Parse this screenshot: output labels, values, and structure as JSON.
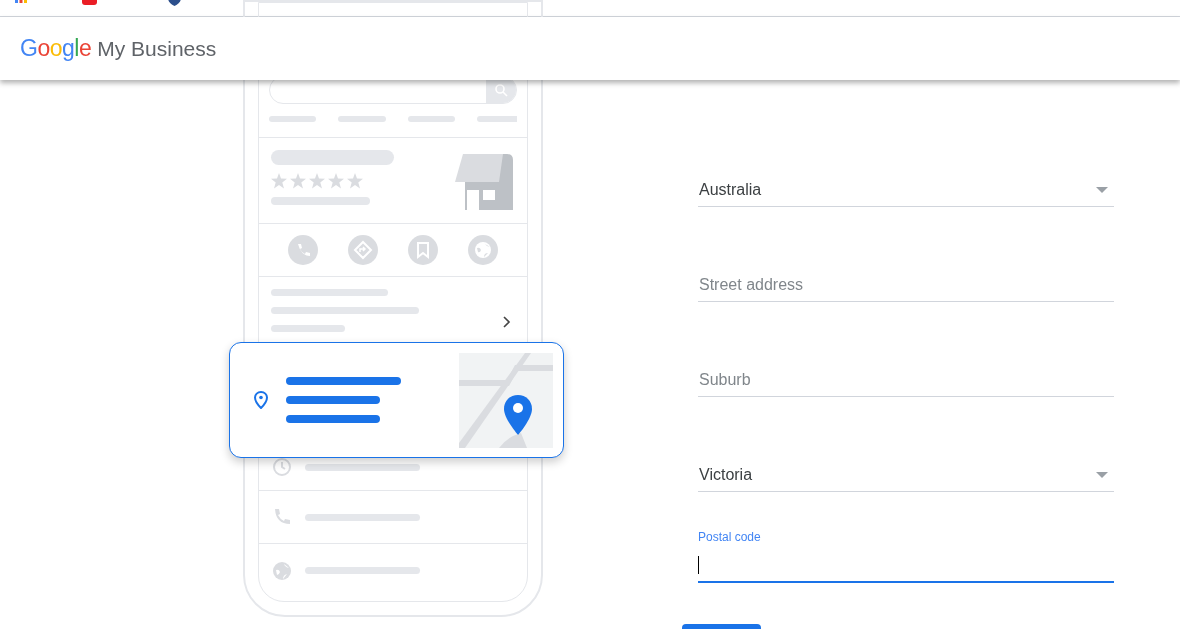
{
  "header": {
    "logo": {
      "brand": "Google",
      "product": "My Business"
    }
  },
  "form": {
    "fields": [
      {
        "kind": "select",
        "value": "Australia"
      },
      {
        "kind": "text",
        "placeholder": "Street address"
      },
      {
        "kind": "text",
        "placeholder": "Suburb"
      },
      {
        "kind": "select",
        "value": "Victoria"
      },
      {
        "kind": "text",
        "label": "Postal code",
        "focused": true
      }
    ]
  }
}
